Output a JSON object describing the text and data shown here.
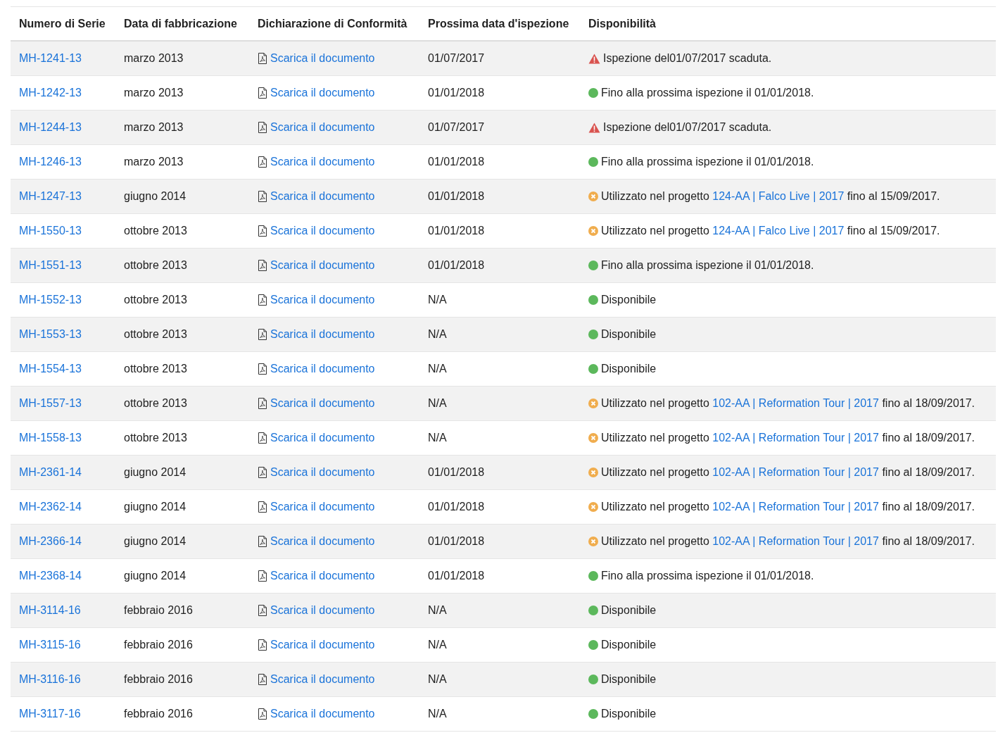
{
  "table": {
    "columns": [
      "Numero di Serie",
      "Data di fabbricazione",
      "Dichiarazione di Conformità",
      "Prossima data d'ispezione",
      "Disponibilità"
    ],
    "rows": [
      {
        "serial": "MH-1241-13",
        "made": "marzo 2013",
        "document": "Scarica il documento",
        "next": "01/07/2017",
        "status": {
          "kind": "expired",
          "text": "Ispezione del01/07/2017 scaduta."
        }
      },
      {
        "serial": "MH-1242-13",
        "made": "marzo 2013",
        "document": "Scarica il documento",
        "next": "01/01/2018",
        "status": {
          "kind": "ok",
          "text": "Fino alla prossima ispezione il 01/01/2018."
        }
      },
      {
        "serial": "MH-1244-13",
        "made": "marzo 2013",
        "document": "Scarica il documento",
        "next": "01/07/2017",
        "status": {
          "kind": "expired",
          "text": "Ispezione del01/07/2017 scaduta."
        }
      },
      {
        "serial": "MH-1246-13",
        "made": "marzo 2013",
        "document": "Scarica il documento",
        "next": "01/01/2018",
        "status": {
          "kind": "ok",
          "text": "Fino alla prossima ispezione il 01/01/2018."
        }
      },
      {
        "serial": "MH-1247-13",
        "made": "giugno 2014",
        "document": "Scarica il documento",
        "next": "01/01/2018",
        "status": {
          "kind": "in_use",
          "text": "Utilizzato nel progetto",
          "link": "124-AA | Falco Live | 2017",
          "after": "fino al 15/09/2017."
        }
      },
      {
        "serial": "MH-1550-13",
        "made": "ottobre 2013",
        "document": "Scarica il documento",
        "next": "01/01/2018",
        "status": {
          "kind": "in_use",
          "text": "Utilizzato nel progetto",
          "link": "124-AA | Falco Live | 2017",
          "after": "fino al 15/09/2017."
        }
      },
      {
        "serial": "MH-1551-13",
        "made": "ottobre 2013",
        "document": "Scarica il documento",
        "next": "01/01/2018",
        "status": {
          "kind": "ok",
          "text": "Fino alla prossima ispezione il 01/01/2018."
        }
      },
      {
        "serial": "MH-1552-13",
        "made": "ottobre 2013",
        "document": "Scarica il documento",
        "next": "N/A",
        "status": {
          "kind": "available",
          "text": "Disponibile"
        }
      },
      {
        "serial": "MH-1553-13",
        "made": "ottobre 2013",
        "document": "Scarica il documento",
        "next": "N/A",
        "status": {
          "kind": "available",
          "text": "Disponibile"
        }
      },
      {
        "serial": "MH-1554-13",
        "made": "ottobre 2013",
        "document": "Scarica il documento",
        "next": "N/A",
        "status": {
          "kind": "available",
          "text": "Disponibile"
        }
      },
      {
        "serial": "MH-1557-13",
        "made": "ottobre 2013",
        "document": "Scarica il documento",
        "next": "N/A",
        "status": {
          "kind": "in_use",
          "text": "Utilizzato nel progetto",
          "link": "102-AA | Reformation Tour | 2017",
          "after": "fino al 18/09/2017."
        }
      },
      {
        "serial": "MH-1558-13",
        "made": "ottobre 2013",
        "document": "Scarica il documento",
        "next": "N/A",
        "status": {
          "kind": "in_use",
          "text": "Utilizzato nel progetto",
          "link": "102-AA | Reformation Tour | 2017",
          "after": "fino al 18/09/2017."
        }
      },
      {
        "serial": "MH-2361-14",
        "made": "giugno 2014",
        "document": "Scarica il documento",
        "next": "01/01/2018",
        "status": {
          "kind": "in_use",
          "text": "Utilizzato nel progetto",
          "link": "102-AA | Reformation Tour | 2017",
          "after": "fino al 18/09/2017."
        }
      },
      {
        "serial": "MH-2362-14",
        "made": "giugno 2014",
        "document": "Scarica il documento",
        "next": "01/01/2018",
        "status": {
          "kind": "in_use",
          "text": "Utilizzato nel progetto",
          "link": "102-AA | Reformation Tour | 2017",
          "after": "fino al 18/09/2017."
        }
      },
      {
        "serial": "MH-2366-14",
        "made": "giugno 2014",
        "document": "Scarica il documento",
        "next": "01/01/2018",
        "status": {
          "kind": "in_use",
          "text": "Utilizzato nel progetto",
          "link": "102-AA | Reformation Tour | 2017",
          "after": "fino al 18/09/2017."
        }
      },
      {
        "serial": "MH-2368-14",
        "made": "giugno 2014",
        "document": "Scarica il documento",
        "next": "01/01/2018",
        "status": {
          "kind": "ok",
          "text": "Fino alla prossima ispezione il 01/01/2018."
        }
      },
      {
        "serial": "MH-3114-16",
        "made": "febbraio 2016",
        "document": "Scarica il documento",
        "next": "N/A",
        "status": {
          "kind": "available",
          "text": "Disponibile"
        }
      },
      {
        "serial": "MH-3115-16",
        "made": "febbraio 2016",
        "document": "Scarica il documento",
        "next": "N/A",
        "status": {
          "kind": "available",
          "text": "Disponibile"
        }
      },
      {
        "serial": "MH-3116-16",
        "made": "febbraio 2016",
        "document": "Scarica il documento",
        "next": "N/A",
        "status": {
          "kind": "available",
          "text": "Disponibile"
        }
      },
      {
        "serial": "MH-3117-16",
        "made": "febbraio 2016",
        "document": "Scarica il documento",
        "next": "N/A",
        "status": {
          "kind": "available",
          "text": "Disponibile"
        }
      }
    ]
  }
}
